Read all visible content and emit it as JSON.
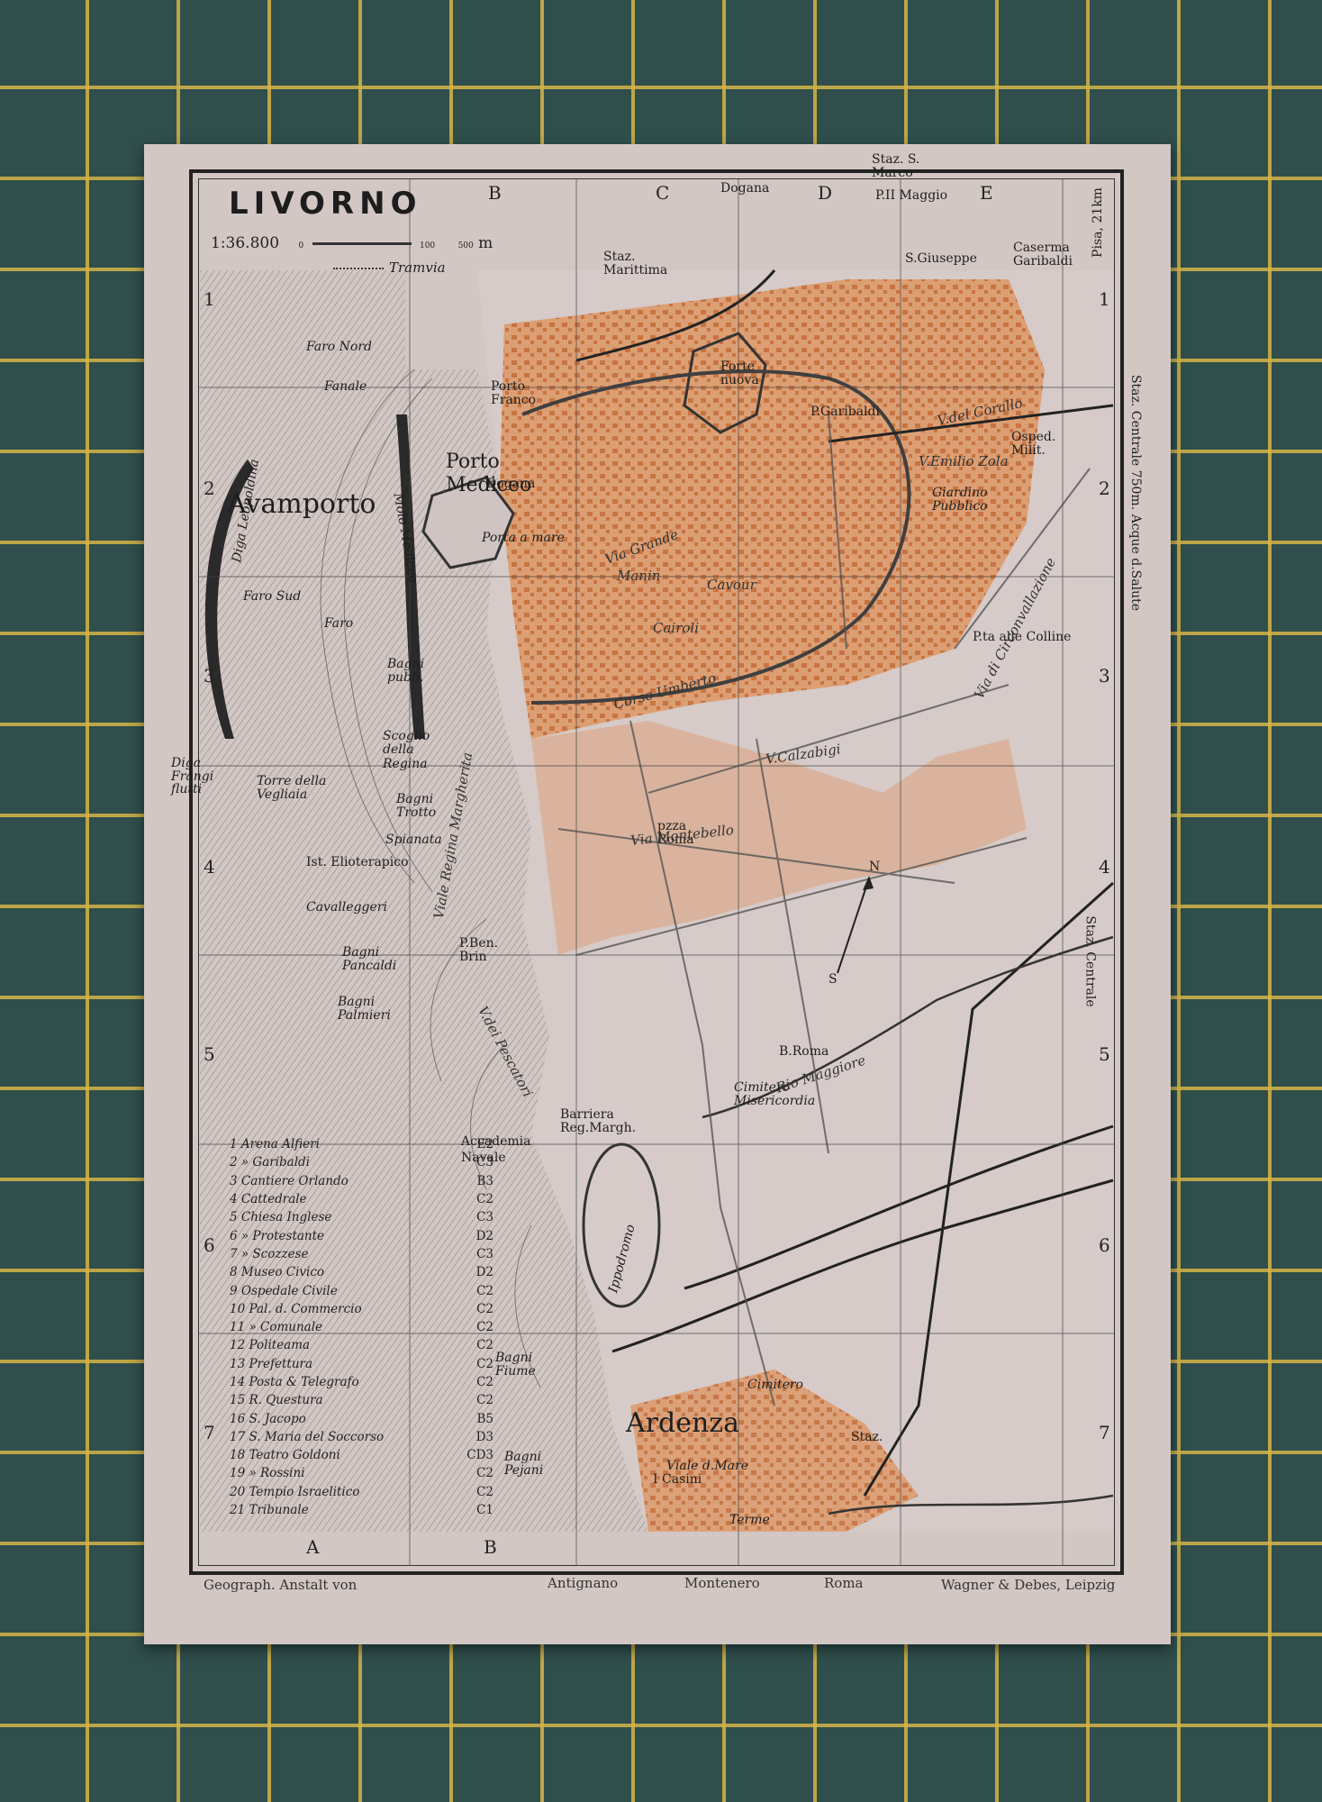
{
  "map": {
    "title": "LIVORNO",
    "scale": "1:36.800",
    "scale_ticks": [
      "0",
      "100",
      "500",
      "m"
    ],
    "tramvia": "Tramvia",
    "col_letters_top": [
      "B",
      "C",
      "D",
      "E"
    ],
    "col_letters_bottom": [
      "A",
      "B"
    ],
    "row_numbers_left": [
      "1",
      "2",
      "3",
      "4",
      "5",
      "6",
      "7"
    ],
    "row_numbers_right": [
      "1",
      "2",
      "3",
      "4",
      "5",
      "6",
      "7"
    ],
    "places": {
      "avamporto": "Avamporto",
      "porto_mediceo": "Porto Mediceo",
      "ardenza": "Ardenza",
      "faro_nord": "Faro Nord",
      "fanale": "Fanale",
      "faro_sud": "Faro Sud",
      "faro": "Faro",
      "diga_leopoldina": "Diga Leopoldina",
      "molo_mediceo": "Molo Mediceo",
      "stazione_marittima": "Staz. Marittima",
      "dogana_top": "Dogana",
      "stazione_s_marco": "Staz. S. Marco",
      "p_xx_maggio": "P.II Maggio",
      "s_giuseppe": "S.Giuseppe",
      "caserma_garibaldi": "Caserma Garibaldi",
      "porto_franco": "Porto Franco",
      "fortezza_nuova": "Forte nuova",
      "p_garibaldi": "P.Garibaldi",
      "osped_milit": "Osped. Milit.",
      "giardino_pubblico": "Giardino Pubblico",
      "dogana_porto": "Dogana",
      "porta_a_mare": "Porta a mare",
      "pza_alle_colline": "P.ta alle Colline",
      "bagni_pubbl": "Bagni pubb.",
      "scoglio_della_regina": "Scoglio della Regina",
      "torre_della_vegliaia": "Torre della Vegliaia",
      "diga_frangiflutti": "Diga Frangi flutti",
      "bagni_trotto": "Bagni Trotto",
      "spianata": "Spianata",
      "ist_elioterapico": "Ist. Elioterapico",
      "cavalleggeri": "Cavalleggeri",
      "bagni_pancaldi": "Bagni Pancaldi",
      "bagni_palmieri": "Bagni Palmieri",
      "pza_montebello": "Montebello",
      "pza_roma": "pzza Roma",
      "b_roma": "B.Roma",
      "cimitero_misericordia": "Cimitero Misericordia",
      "barriera_regina_margherita": "Barriera Reg.Margh.",
      "accademia_navale": "Accademia Navale",
      "ippodromo": "Ippodromo",
      "bagni_fiume": "Bagni Fiume",
      "bagni_pejani": "Bagni Pejani",
      "cimitero_ardenza": "Cimitero",
      "staz_ardenza": "Staz.",
      "i_casini": "I Casini",
      "rio_maggiore": "Rio Maggiore",
      "corso_umberto": "Corso Umberto",
      "via_del_corallo": "V.del Corallo",
      "v_emilio_zola": "V.Emilio Zola",
      "via_di_circonvallazione": "Via di Circonvallazione",
      "v_calzabigi": "V.Calzabigi",
      "via_montebello": "Via Montebello",
      "viale_regina_margherita": "Viale Regina Margherita",
      "via_grande": "Via Grande",
      "via_cairoli": "Cairoli",
      "p_cavour": "Cavour",
      "p_manin": "Manin",
      "p_ben_brin": "P.Ben. Brin",
      "terme": "Terme",
      "v_de_pescatori": "V.dei Pescatori",
      "viale_di_ardenza": "Viale d.Mare",
      "stazione_centrale_side": "Staz. Centrale",
      "pisa_side": "Pisa, 21km",
      "staz_centrale_acque": "Staz. Centrale 750m. Acque d.Salute"
    },
    "legend": [
      {
        "label": "1 Arena Alfieri",
        "ref": "E2"
      },
      {
        "label": "2 » Garibaldi",
        "ref": "C3"
      },
      {
        "label": "3 Cantiere Orlando",
        "ref": "B3"
      },
      {
        "label": "4 Cattedrale",
        "ref": "C2"
      },
      {
        "label": "5 Chiesa Inglese",
        "ref": "C3"
      },
      {
        "label": "6 » Protestante",
        "ref": "D2"
      },
      {
        "label": "7 » Scozzese",
        "ref": "C3"
      },
      {
        "label": "8 Museo Civico",
        "ref": "D2"
      },
      {
        "label": "9 Ospedale Civile",
        "ref": "C2"
      },
      {
        "label": "10 Pal. d. Commercio",
        "ref": "C2"
      },
      {
        "label": "11 » Comunale",
        "ref": "C2"
      },
      {
        "label": "12 Politeama",
        "ref": "C2"
      },
      {
        "label": "13 Prefettura",
        "ref": "C2"
      },
      {
        "label": "14 Posta & Telegrafo",
        "ref": "C2"
      },
      {
        "label": "15 R. Questura",
        "ref": "C2"
      },
      {
        "label": "16 S. Jacopo",
        "ref": "B5"
      },
      {
        "label": "17 S. Maria del Soccorso",
        "ref": "D3"
      },
      {
        "label": "18 Teatro Goldoni",
        "ref": "CD3"
      },
      {
        "label": "19 » Rossini",
        "ref": "C2"
      },
      {
        "label": "20 Tempio Israelitico",
        "ref": "C2"
      },
      {
        "label": "21 Tribunale",
        "ref": "C1"
      }
    ],
    "footer": {
      "left": "Geograph. Anstalt von",
      "antignano": "Antignano",
      "montenero": "Montenero",
      "roma": "Roma",
      "right": "Wagner & Debes, Leipzig"
    },
    "compass": {
      "north": "N",
      "south": "S"
    },
    "colors": {
      "paper": "#d3c7c4",
      "urban": "#d98f5c",
      "urban_dark": "#c7652e",
      "sea_lines": "#3a3a3a",
      "mat": "#2f4e4c",
      "mat_grid": "#d6b446"
    }
  }
}
